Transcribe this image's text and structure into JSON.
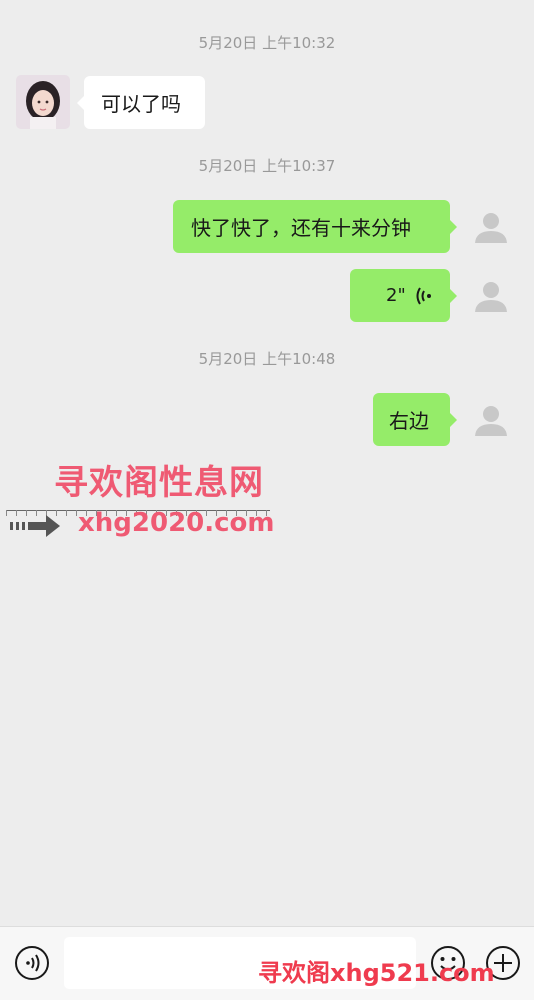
{
  "chat": {
    "ts1": "5月20日 上午10:32",
    "msg1": "可以了吗",
    "ts2": "5月20日 上午10:37",
    "msg2": "快了快了，还有十来分钟",
    "voice_duration": "2\"",
    "ts3": "5月20日 上午10:48",
    "msg4": "右边"
  },
  "watermark": {
    "title": "寻欢阁性息网",
    "url": "xhg2020.com",
    "bottom": "寻欢阁xhg521.com"
  },
  "colors": {
    "background": "#ededed",
    "bubble_out": "#95ec69",
    "bubble_in": "#ffffff",
    "watermark": "#ef5a73"
  },
  "icons": [
    "voice-toggle-icon",
    "emoji-icon",
    "plus-icon",
    "user-placeholder-icon",
    "voice-wave-icon"
  ]
}
